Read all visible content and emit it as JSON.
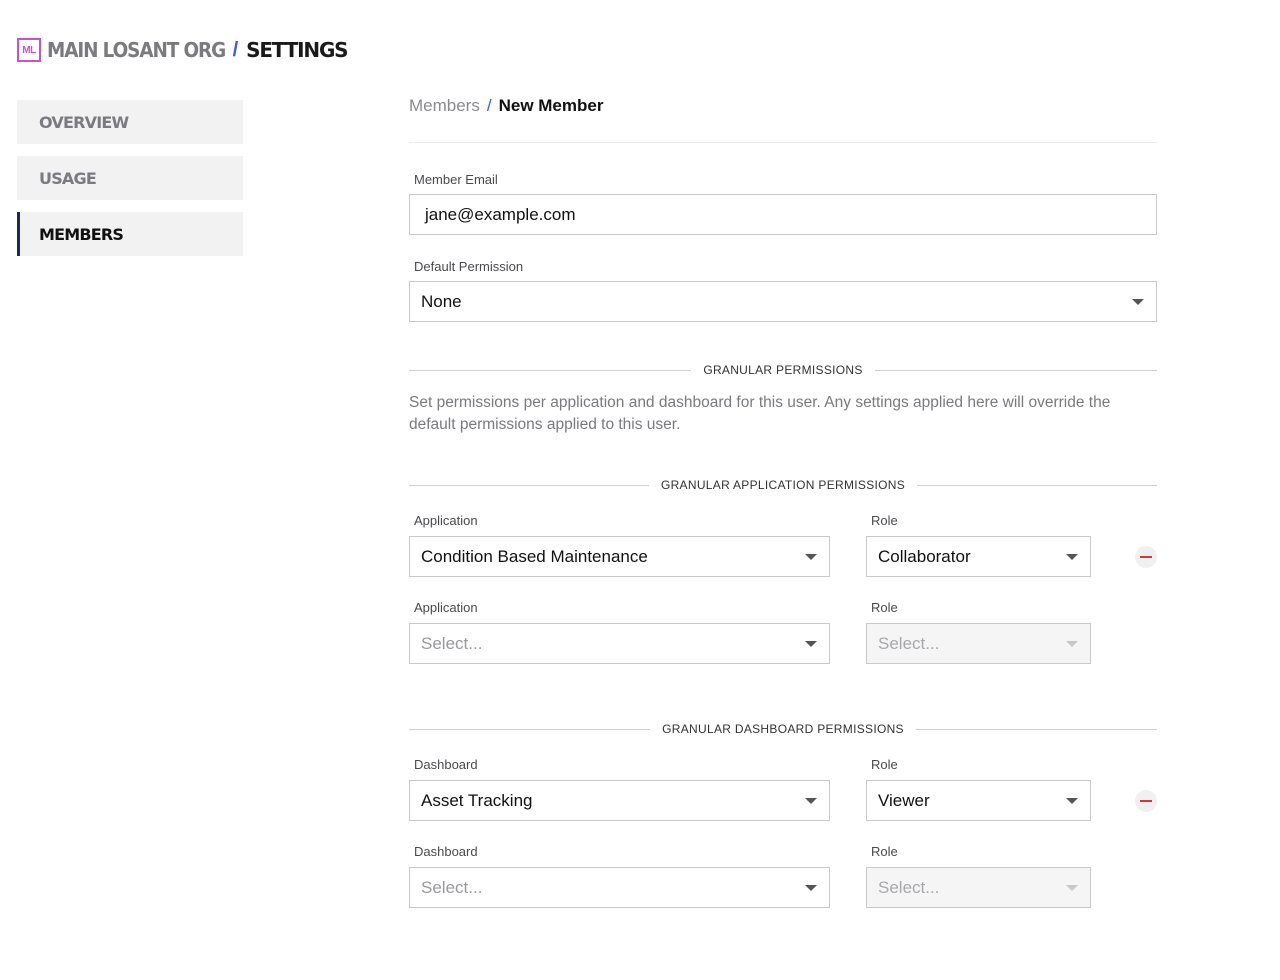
{
  "header": {
    "org_badge": "ML",
    "org_name": "MAIN LOSANT ORG",
    "separator": "/",
    "section": "SETTINGS"
  },
  "sidebar": {
    "items": [
      {
        "label": "OVERVIEW",
        "active": false
      },
      {
        "label": "USAGE",
        "active": false
      },
      {
        "label": "MEMBERS",
        "active": true
      }
    ]
  },
  "breadcrumb": {
    "parent": "Members",
    "separator": "/",
    "current": "New Member"
  },
  "form": {
    "email_label": "Member Email",
    "email_value": "jane@example.com",
    "default_permission_label": "Default Permission",
    "default_permission_value": "None"
  },
  "granular": {
    "title": "GRANULAR PERMISSIONS",
    "description": "Set permissions per application and dashboard for this user. Any settings applied here will override the default permissions applied to this user."
  },
  "app_permissions": {
    "title": "GRANULAR APPLICATION PERMISSIONS",
    "rows": [
      {
        "field_label": "Application",
        "value": "Condition Based Maintenance",
        "role_label": "Role",
        "role": "Collaborator",
        "removable": true
      },
      {
        "field_label": "Application",
        "value": "Select...",
        "role_label": "Role",
        "role": "Select...",
        "removable": false
      }
    ]
  },
  "dashboard_permissions": {
    "title": "GRANULAR DASHBOARD PERMISSIONS",
    "rows": [
      {
        "field_label": "Dashboard",
        "value": "Asset Tracking",
        "role_label": "Role",
        "role": "Viewer",
        "removable": true
      },
      {
        "field_label": "Dashboard",
        "value": "Select...",
        "role_label": "Role",
        "role": "Select...",
        "removable": false
      }
    ]
  },
  "colors": {
    "accent": "#3a5bd9",
    "badge": "#c455c8",
    "remove": "#d23a3a"
  }
}
